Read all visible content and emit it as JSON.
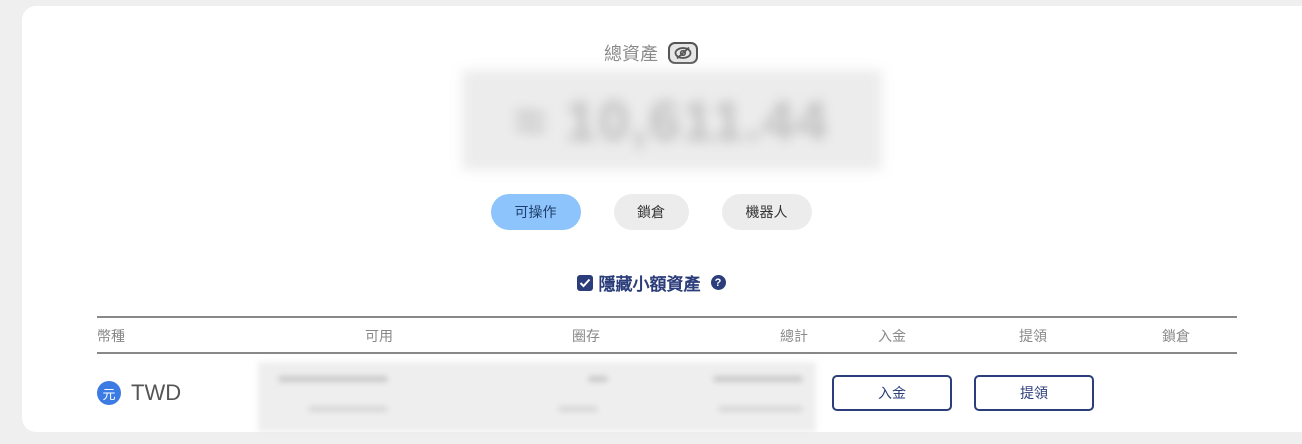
{
  "total": {
    "label": "總資產",
    "eye_icon": "eye-off-icon",
    "balance_masked": "≈ 10,611.44"
  },
  "tabs": [
    {
      "label": "可操作",
      "active": true
    },
    {
      "label": "鎖倉",
      "active": false
    },
    {
      "label": "機器人",
      "active": false
    }
  ],
  "hide_small": {
    "label": "隱藏小額資產",
    "checked": true,
    "help": "?"
  },
  "table": {
    "headers": [
      "幣種",
      "可用",
      "圈存",
      "總計",
      "入金",
      "提領",
      "鎖倉"
    ],
    "rows": [
      {
        "coin_icon_text": "元",
        "coin": "TWD",
        "deposit_label": "入金",
        "withdraw_label": "提領"
      }
    ]
  },
  "colors": {
    "accent": "#2b3d7a",
    "active_tab": "#8cc4fb",
    "coin_icon": "#3b7be3"
  }
}
